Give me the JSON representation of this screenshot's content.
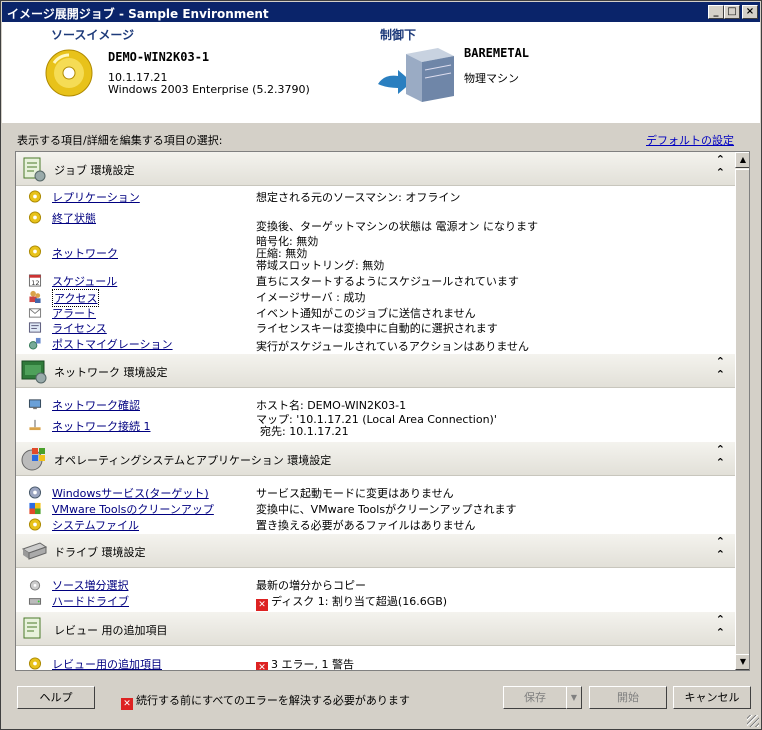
{
  "window": {
    "title": "イメージ展開ジョブ - Sample Environment",
    "min": "_",
    "max": "□",
    "close": "×"
  },
  "source": {
    "label": "ソースイメージ",
    "name": "DEMO-WIN2K03-1",
    "ip": "10.1.17.21",
    "os": "Windows 2003 Enterprise (5.2.3790)"
  },
  "target": {
    "label": "制御下",
    "name": "BAREMETAL",
    "type": "物理マシン"
  },
  "select_label": "表示する項目/詳細を編集する項目の選択:",
  "default_link": "デフォルトの設定",
  "sections": {
    "job": {
      "title": "ジョブ 環境設定",
      "chevron": "⌃⌃",
      "rows": [
        {
          "label": "レプリケーション",
          "value": "想定される元のソースマシン: オフライン"
        },
        {
          "label": "終了状態",
          "value": "変換後、ターゲットマシンの状態は 電源オン になります"
        },
        {
          "label": "ネットワーク",
          "value1": "暗号化: 無効",
          "value2": "圧縮: 無効",
          "value3": "帯域スロットリング: 無効"
        },
        {
          "label": "スケジュール",
          "value": "直ちにスタートするようにスケジュールされています"
        },
        {
          "label": "アクセス",
          "value": "イメージサーバ : 成功"
        },
        {
          "label": "アラート",
          "value": "イベント通知がこのジョブに送信されません"
        },
        {
          "label": "ライセンス",
          "value": "ライセンスキーは変換中に自動的に選択されます"
        },
        {
          "label": "ポストマイグレーション",
          "value": "実行がスケジュールされているアクションはありません"
        }
      ]
    },
    "network": {
      "title": "ネットワーク 環境設定",
      "chevron": "⌃⌃",
      "rows": [
        {
          "label": "ネットワーク確認",
          "value": "ホスト名: DEMO-WIN2K03-1"
        },
        {
          "label": "ネットワーク接続 1",
          "value1": "マップ: '10.1.17.21 (Local Area Connection)'",
          "value2": "宛先: 10.1.17.21"
        }
      ]
    },
    "os": {
      "title": "オペレーティングシステムとアプリケーション 環境設定",
      "chevron": "⌃⌃",
      "rows": [
        {
          "label": "Windowsサービス(ターゲット)",
          "value": "サービス起動モードに変更はありません"
        },
        {
          "label": "VMware Toolsのクリーンアップ",
          "value": "変換中に、VMware Toolsがクリーンアップされます"
        },
        {
          "label": "システムファイル",
          "value": "置き換える必要があるファイルはありません"
        }
      ]
    },
    "drive": {
      "title": "ドライブ 環境設定",
      "chevron": "⌃⌃",
      "rows": [
        {
          "label": "ソース増分選択",
          "value": "最新の増分からコピー"
        },
        {
          "label": "ハードドライブ",
          "value": "ディスク 1: 割り当て超過(16.6GB)"
        }
      ]
    },
    "review": {
      "title": "レビュー 用の追加項目",
      "chevron": "⌃⌃",
      "rows": [
        {
          "label": "レビュー用の追加項目",
          "value": "3 エラー, 1 警告"
        }
      ]
    }
  },
  "footer": {
    "help": "ヘルプ",
    "message": "続行する前にすべてのエラーを解決する必要があります",
    "save": "保存",
    "start": "開始",
    "cancel": "キャンセル"
  },
  "colors": {
    "title_bg": "#0a246a",
    "link": "#000080",
    "error": "#dd2222"
  }
}
